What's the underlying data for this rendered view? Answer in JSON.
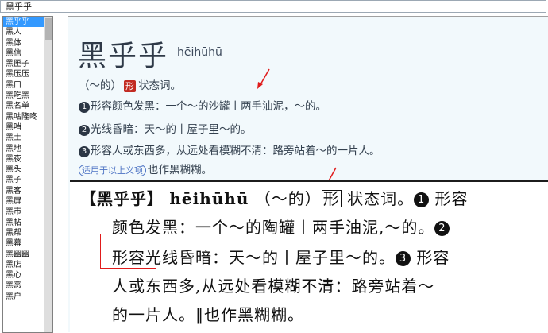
{
  "window": {
    "title": "黑乎乎"
  },
  "sidebar": {
    "items": [
      "黑乎乎",
      "黑人",
      "黑体",
      "黑信",
      "黑匣子",
      "黑压压",
      "黑口",
      "黑吃黑",
      "黑名单",
      "黑咕隆咚",
      "黑哨",
      "黑土",
      "黑地",
      "黑夜",
      "黑头",
      "黑子",
      "黑客",
      "黑屏",
      "黑市",
      "黑帖",
      "黑帮",
      "黑幕",
      "黑幽幽",
      "黑店",
      "黑心",
      "黑恶",
      "黑户"
    ],
    "selected_index": 0
  },
  "entry": {
    "headword": "黑乎乎",
    "pinyin": "hēihūhū",
    "grammar_prefix": "（～的）",
    "pos_badge": "形",
    "pos_text": "状态词。",
    "senses": [
      {
        "num": "1",
        "text": "形容颜色发黑：一个～的沙罐丨两手油泥，～的。"
      },
      {
        "num": "2",
        "text": "光线昏暗：天～的丨屋子里～的。"
      },
      {
        "num": "3",
        "text": "形容人或东西多，从远处看模糊不清：路旁站着～的一片人。"
      }
    ],
    "scope_tag": "适用于以上义项",
    "also_written": "也作黑糊糊。"
  },
  "scan": {
    "line1_bracket": "【黑乎乎】",
    "line1_pinyin": "hēihūhū",
    "line1_paren": "（～的）",
    "line1_pos": "形",
    "line1_rest": "状态词。",
    "line1_num": "1",
    "line1_tail": "形容",
    "line2": "颜色发黑：一个～的陶罐丨两手油泥,～的。",
    "line2_num": "2",
    "line3_head": "形容光线昏暗：天～的丨屋子里～的。",
    "line3_num": "3",
    "line3_tail": "形容",
    "line4": "人或东西多,从远处看模糊不清：路旁站着～",
    "line5": "的一片人。‖也作黑糊糊。"
  },
  "colors": {
    "accent_red": "#e01b1b",
    "badge_red": "#c22b22",
    "selection_blue": "#3399ff",
    "pane_bg": "#f2f9fc"
  }
}
